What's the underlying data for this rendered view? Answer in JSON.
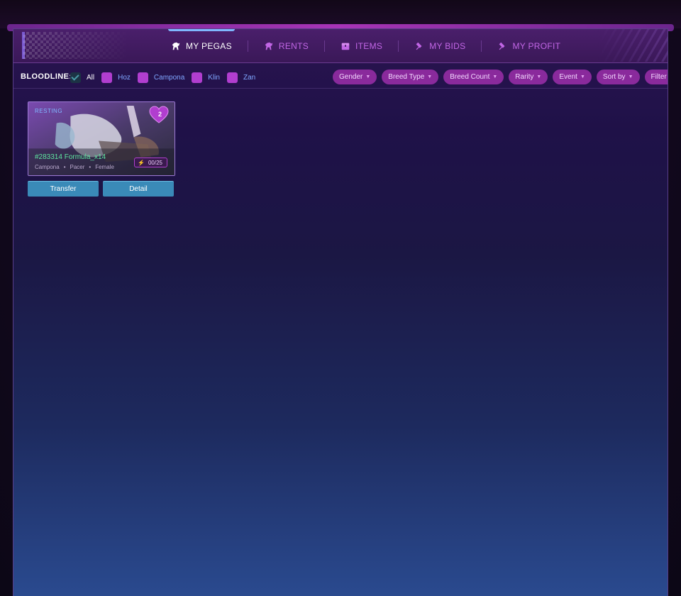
{
  "nav": {
    "tabs": [
      {
        "label": "MY PEGAS",
        "icon": "horse-icon",
        "active": true
      },
      {
        "label": "RENTS",
        "icon": "horse-icon",
        "active": false
      },
      {
        "label": "ITEMS",
        "icon": "chest-icon",
        "active": false
      },
      {
        "label": "MY BIDS",
        "icon": "gavel-icon",
        "active": false
      },
      {
        "label": "MY PROFIT",
        "icon": "gavel-icon",
        "active": false
      }
    ]
  },
  "filters": {
    "bloodline_label": "BLOODLINE:",
    "bloodline_options": [
      {
        "label": "All",
        "checked": true
      },
      {
        "label": "Hoz",
        "checked": false
      },
      {
        "label": "Campona",
        "checked": false
      },
      {
        "label": "Klin",
        "checked": false
      },
      {
        "label": "Zan",
        "checked": false
      }
    ],
    "dropdowns": [
      "Gender",
      "Breed Type",
      "Breed Count",
      "Rarity",
      "Event",
      "Sort by",
      "Filter By"
    ]
  },
  "card": {
    "status": "RESTING",
    "heart_count": "2",
    "name": "#283314 Formula_x14",
    "meta": [
      "Campona",
      "Pacer",
      "Female"
    ],
    "energy": "00/25",
    "transfer_label": "Transfer",
    "detail_label": "Detail"
  },
  "colors": {
    "accent": "#b13ecf",
    "button": "#3a8ab8",
    "name_green": "#5ee6a0",
    "tab_inactive": "#c266e6"
  }
}
